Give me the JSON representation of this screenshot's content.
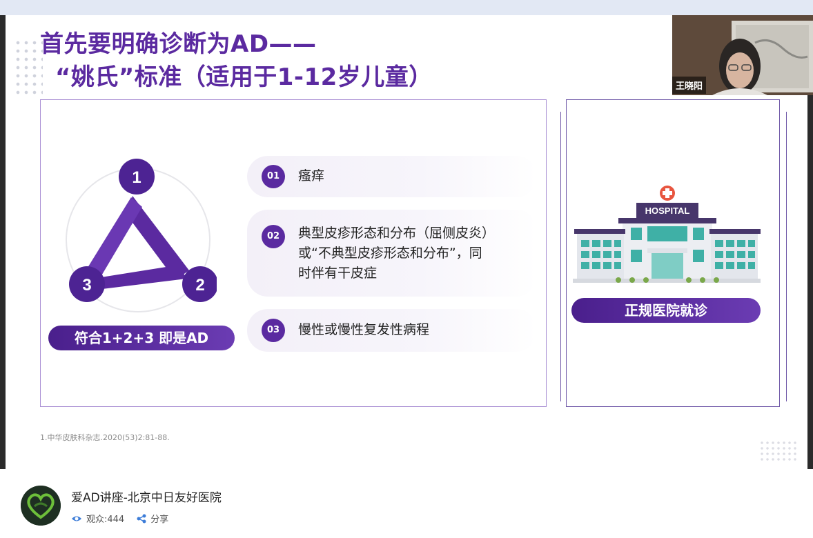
{
  "slide": {
    "title_line1": "首先要明确诊断为AD——",
    "title_line2": "“姚氏”标准（适用于1-12岁儿童）",
    "triangle": {
      "n1": "1",
      "n2": "2",
      "n3": "3"
    },
    "ad_pill": "符合1+2+3 即是AD",
    "items": [
      {
        "num": "01",
        "text": "瘙痒"
      },
      {
        "num": "02",
        "line1": "典型皮疹形态和分布（屈侧皮炎）",
        "line2": "或“不典型皮疹形态和分布”，同",
        "line3": "时伴有干皮症"
      },
      {
        "num": "03",
        "text": "慢性或慢性复发性病程"
      }
    ],
    "hospital_sign": "HOSPITAL",
    "hospital_pill": "正规医院就诊",
    "reference": "1.中华皮肤科杂志.2020(53)2:81-88.",
    "colors": {
      "primary": "#5b2aa0",
      "pill_start": "#4a1f8c",
      "pill_end": "#6b3cb3"
    }
  },
  "camera": {
    "name": "王晓阳"
  },
  "footer": {
    "room_title": "爱AD讲座-北京中日友好医院",
    "viewers": "观众:444",
    "share": "分享",
    "icons": [
      "eye-icon",
      "share-icon"
    ]
  }
}
